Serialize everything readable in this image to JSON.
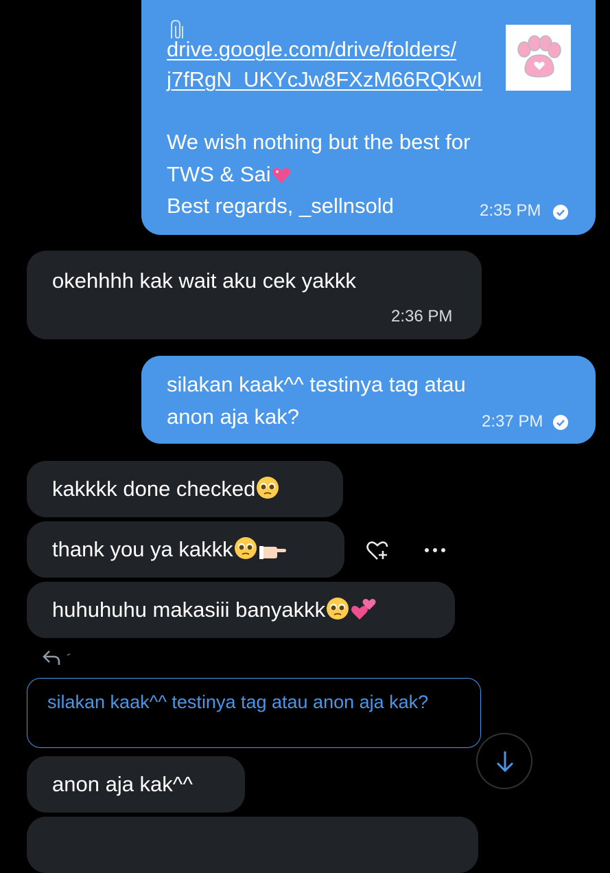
{
  "messages": [
    {
      "id": "m1",
      "direction": "sent",
      "link_line1": "drive.google.com/drive/folders/",
      "link_line2": "j7fRgN_UKYcJw8FXzM66RQKwI",
      "text_line1": "We wish nothing but the best for",
      "text_line2": "TWS & Sai",
      "text_line3": "Best regards, _sellnsold",
      "time": "2:35 PM"
    },
    {
      "id": "m2",
      "direction": "received",
      "text": "okehhhh kak wait aku cek yakkk",
      "time": "2:36 PM"
    },
    {
      "id": "m3",
      "direction": "sent",
      "text_line1": "silakan kaak^^ testinya tag atau",
      "text_line2": "anon aja kak?",
      "time": "2:37 PM"
    },
    {
      "id": "m4",
      "direction": "received",
      "text": "kakkkk done checked"
    },
    {
      "id": "m5",
      "direction": "received",
      "text": "thank you ya kakkk"
    },
    {
      "id": "m6",
      "direction": "received",
      "text": "huhuhuhu makasiii banyakkk"
    },
    {
      "id": "m7",
      "direction": "received",
      "quoted_text": "silakan kaak^^ testinya tag atau anon aja kak?",
      "text": "anon aja kak^^"
    }
  ],
  "icons": {
    "link_preview": "cat-paw-icon",
    "clip": "paperclip-icon",
    "read_receipt": "check-circle-icon",
    "react": "heart-plus-icon",
    "more": "more-dots-icon",
    "reply": "reply-arrow-icon",
    "scroll": "arrow-down-icon"
  },
  "colors": {
    "background": "#000000",
    "sent_bubble": "#4a96e8",
    "received_bubble": "#202327",
    "accent": "#4a96e8"
  }
}
